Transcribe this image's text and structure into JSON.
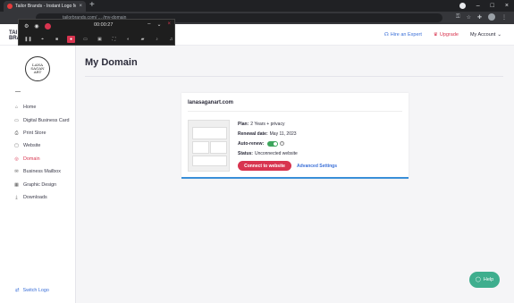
{
  "browser": {
    "tab_title": "Tailor Brands - Instant Logo Mak",
    "tab_close": "×",
    "new_tab": "+",
    "url": "tailorbrands.com/ ... /my-domain",
    "win_min": "–",
    "win_max": "□",
    "win_close": "×"
  },
  "header": {
    "logo_line1": "TAI",
    "logo_line2": "BRA",
    "hire_label": "Hire an Expert",
    "upgrade_label": "Upgrade",
    "account_label": "My Account"
  },
  "sidebar": {
    "brand_text_1": "LANA",
    "brand_text_2": "SAGAN",
    "brand_text_3": "ART",
    "items": [
      {
        "label": "Home",
        "icon": "home-icon",
        "glyph": "⌂"
      },
      {
        "label": "Digital Business Card",
        "icon": "card-icon",
        "glyph": "▭"
      },
      {
        "label": "Print Store",
        "icon": "print-icon",
        "glyph": "⎙"
      },
      {
        "label": "Website",
        "icon": "monitor-icon",
        "glyph": "▢"
      },
      {
        "label": "Domain",
        "icon": "globe-icon",
        "glyph": "◎"
      },
      {
        "label": "Business Mailbox",
        "icon": "mail-icon",
        "glyph": "✉"
      },
      {
        "label": "Graphic Design",
        "icon": "grid-icon",
        "glyph": "▦"
      },
      {
        "label": "Downloads",
        "icon": "download-icon",
        "glyph": "⤓"
      }
    ],
    "switch_logo_label": "Switch Logo"
  },
  "main": {
    "page_title": "My Domain",
    "card": {
      "domain": "lanasaganart.com",
      "plan_label": "Plan:",
      "plan_value": "2 Years + privacy",
      "renewal_label": "Renewal date:",
      "renewal_value": "May 11, 2023",
      "autorenew_label": "Auto-renew:",
      "status_label": "Status:",
      "status_value": "Unconnected website",
      "connect_button": "Connect to website",
      "advanced_link": "Advanced Settings"
    },
    "help_button": "Help"
  },
  "recorder": {
    "timer": "00:00:27"
  },
  "colors": {
    "accent_red": "#d8344f",
    "link_blue": "#3a6fd8",
    "toggle_green": "#3da55c",
    "help_teal": "#3fae8e"
  }
}
